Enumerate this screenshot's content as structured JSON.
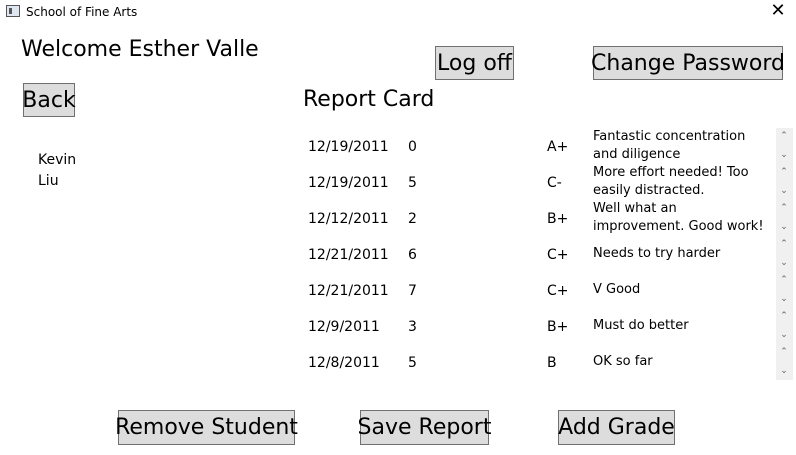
{
  "window": {
    "title": "School of Fine Arts",
    "close_glyph": "✕"
  },
  "header": {
    "welcome": "Welcome Esther Valle"
  },
  "buttons": {
    "log_off": "Log off",
    "change_password": "Change Password",
    "back": "Back",
    "remove_student": "Remove Student",
    "save_report": "Save Report",
    "add_grade": "Add Grade"
  },
  "report": {
    "title": "Report Card",
    "rows": [
      {
        "date": "12/19/2011",
        "value": "0",
        "grade": "A+",
        "comment": "Fantastic concentration and diligence"
      },
      {
        "date": "12/19/2011",
        "value": "5",
        "grade": "C-",
        "comment": "More effort needed! Too easily distracted."
      },
      {
        "date": "12/12/2011",
        "value": "2",
        "grade": "B+",
        "comment": "Well what an improvement. Good work!"
      },
      {
        "date": "12/21/2011",
        "value": "6",
        "grade": "C+",
        "comment": "Needs to try harder"
      },
      {
        "date": "12/21/2011",
        "value": "7",
        "grade": "C+",
        "comment": "V Good"
      },
      {
        "date": "12/9/2011",
        "value": "3",
        "grade": "B+",
        "comment": "Must do better"
      },
      {
        "date": "12/8/2011",
        "value": "5",
        "grade": "B",
        "comment": "OK so far"
      }
    ]
  },
  "student_list": {
    "items": [
      "Kevin",
      "Liu"
    ]
  },
  "icons": {
    "scroll_up": "⌃",
    "scroll_down": "⌄"
  }
}
